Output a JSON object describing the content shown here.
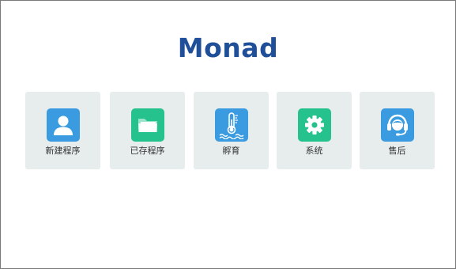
{
  "brand": {
    "logo_text": "Monad",
    "logo_color": "#1e4f98"
  },
  "menu": {
    "items": [
      {
        "label": "新建程序",
        "icon": "user-icon",
        "color": "#3a9be0"
      },
      {
        "label": "已存程序",
        "icon": "folder-icon",
        "color": "#25c28e"
      },
      {
        "label": "孵育",
        "icon": "thermometer-icon",
        "color": "#3a9be0"
      },
      {
        "label": "系统",
        "icon": "gear-icon",
        "color": "#25c28e"
      },
      {
        "label": "售后",
        "icon": "headset-support-icon",
        "color": "#3a9be0"
      }
    ]
  }
}
